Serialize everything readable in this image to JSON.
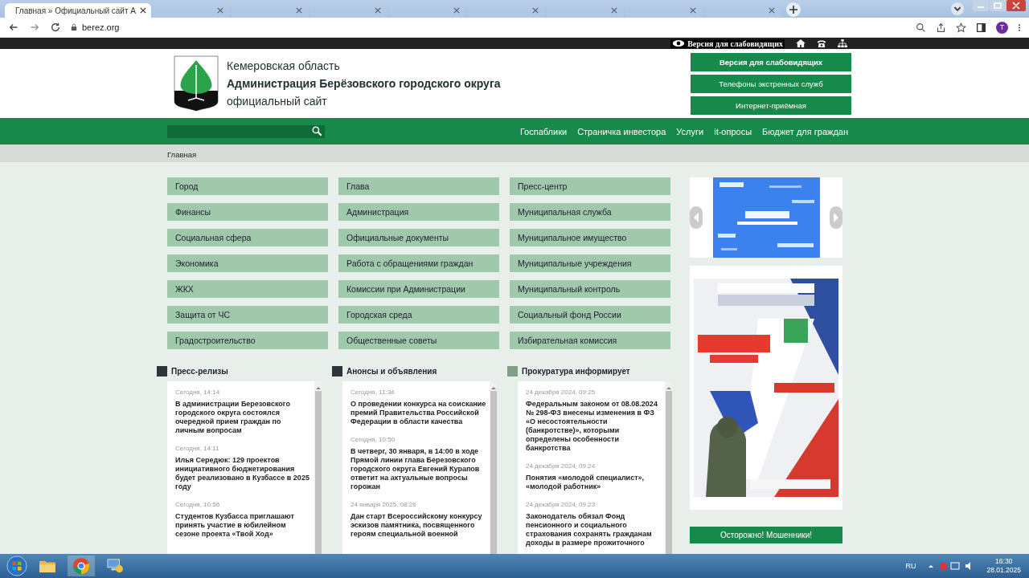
{
  "browser": {
    "tabs": [
      {
        "title": "Главная » Официальный сайт А",
        "selected": true
      },
      {
        "selected": false
      },
      {
        "selected": false
      },
      {
        "selected": false
      },
      {
        "selected": false
      },
      {
        "selected": false
      },
      {
        "selected": false
      },
      {
        "selected": false
      },
      {
        "selected": false
      }
    ],
    "address": "berez.org",
    "profile": "T"
  },
  "top_strip": {
    "label": "Версия для слабовидящих"
  },
  "header": {
    "region": "Кемеровская область",
    "org": "Администрация Берёзовского городского округа",
    "subtitle": "официальный сайт",
    "buttons": [
      "Версия для слабовидящих",
      "Телефоны экстренных служб",
      "Интернет-приёмная"
    ]
  },
  "nav": {
    "links": [
      "Госпаблики",
      "Страничка инвестора",
      "Услуги",
      "it-опросы",
      "Бюджет для граждан"
    ]
  },
  "breadcrumb": [
    "Главная"
  ],
  "menu": [
    [
      "Город",
      "Финансы",
      "Социальная сфера",
      "Экономика",
      "ЖКХ",
      "Защита от ЧС",
      "Градостроительство"
    ],
    [
      "Глава",
      "Администрация",
      "Официальные документы",
      "Работа с обращениями граждан",
      "Комиссии при Администрации",
      "Городская среда",
      "Общественные советы"
    ],
    [
      "Пресс-центр",
      "Муниципальная служба",
      "Муниципальное имущество",
      "Муниципальные учреждения",
      "Муниципальный контроль",
      "Социальный фонд России",
      "Избирательная комиссия"
    ]
  ],
  "news": [
    {
      "title": "Пресс-релизы",
      "color": "#2f343a",
      "items": [
        {
          "date": "Сегодня, 14:14",
          "title": "В администрации Березовского городского округа состоялся очередной прием граждан по личным вопросам"
        },
        {
          "date": "Сегодня, 14:11",
          "title": "Илья Середюк: 129 проектов инициативного бюджетирования будет реализовано в Кузбассе в 2025 году"
        },
        {
          "date": "Сегодня, 10:56",
          "title": "Студентов Кузбасса приглашают принять участие в юбилейном сезоне проекта «Твой Ход»"
        }
      ]
    },
    {
      "title": "Анонсы и объявления",
      "color": "#2f343a",
      "items": [
        {
          "date": "Сегодня, 11:34",
          "title": "О проведении конкурса на соискание премий Правительства Российской Федерации в области качества"
        },
        {
          "date": "Сегодня, 10:50",
          "title": "В четверг, 30 января, в 14:00 в ходе Прямой линии глава Березовского городского округа Евгений Курапов ответит на актуальные вопросы горожан"
        },
        {
          "date": "24 января 2025, 08:26",
          "title": "Дан старт Всероссийскому конкурсу эскизов памятника, посвященного героям специальной военной"
        }
      ]
    },
    {
      "title": "Прокуратура информирует",
      "color": "#7f9f88",
      "items": [
        {
          "date": "24 декабря 2024, 09:25",
          "title": "Федеральным законом от 08.08.2024 № 298-ФЗ внесены изменения в ФЗ «О несостоятельности (банкротстве)», которыми определены особенности банкротства"
        },
        {
          "date": "24 декабря 2024, 09:24",
          "title": "Понятия «молодой специалист», «молодой работник»"
        },
        {
          "date": "24 декабря 2024, 09:23",
          "title": "Законодатель обязал Фонд пенсионного и социального страхования сохранять гражданам доходы в размере прожиточного"
        }
      ]
    }
  ],
  "side": {
    "button": "Осторожно! Мошенники!"
  },
  "taskbar": {
    "lang": "RU",
    "time": "16:30",
    "date": "28.01.2025"
  }
}
